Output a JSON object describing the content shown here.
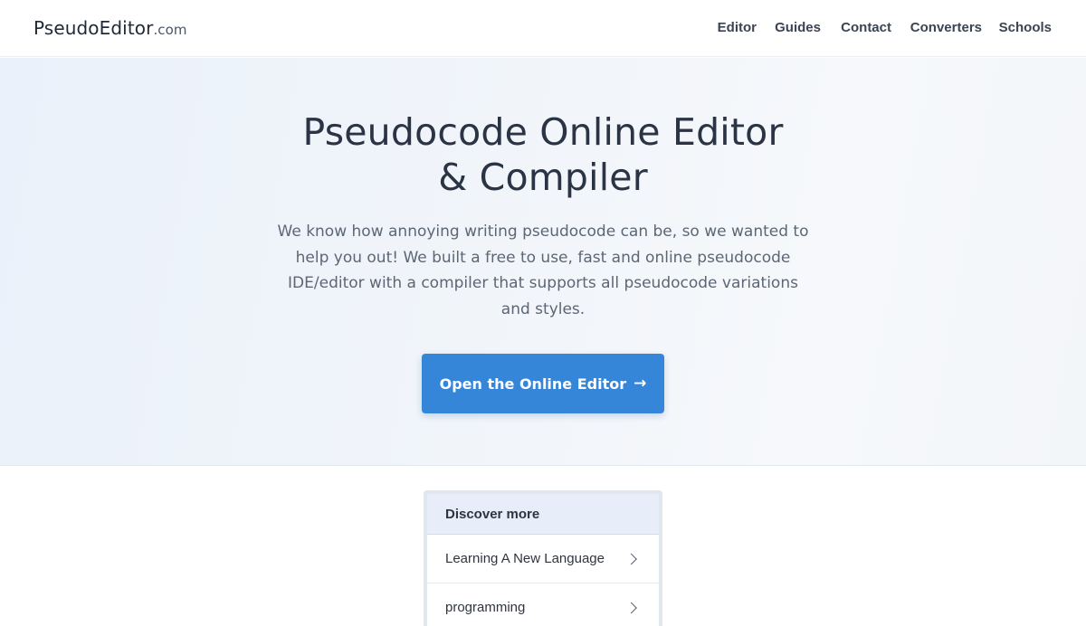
{
  "header": {
    "logo_main": "PseudoEditor",
    "logo_suffix": ".com",
    "nav": [
      {
        "label": "Editor"
      },
      {
        "label": "Guides"
      },
      {
        "label": "Contact"
      },
      {
        "label": "Converters"
      },
      {
        "label": "Schools"
      }
    ]
  },
  "hero": {
    "title_line1": "Pseudocode Online Editor",
    "title_line2": "& Compiler",
    "description": "We know how annoying writing pseudocode can be, so we wanted to help you out! We built a free to use, fast and online pseudocode IDE/editor with a compiler that supports all pseudocode variations and styles.",
    "cta_label": "Open the Online Editor",
    "cta_icon": "arrow-right-icon"
  },
  "discover": {
    "title": "Discover more",
    "items": [
      {
        "label": "Learning A New Language",
        "icon": "chevron-right-icon"
      },
      {
        "label": "programming",
        "icon": "chevron-right-icon"
      }
    ]
  },
  "colors": {
    "accent": "#3585d8",
    "heading": "#2a3444",
    "body_text": "#5c6675",
    "hero_bg": "#eef3f9",
    "discover_header_bg": "#e8eef9"
  }
}
